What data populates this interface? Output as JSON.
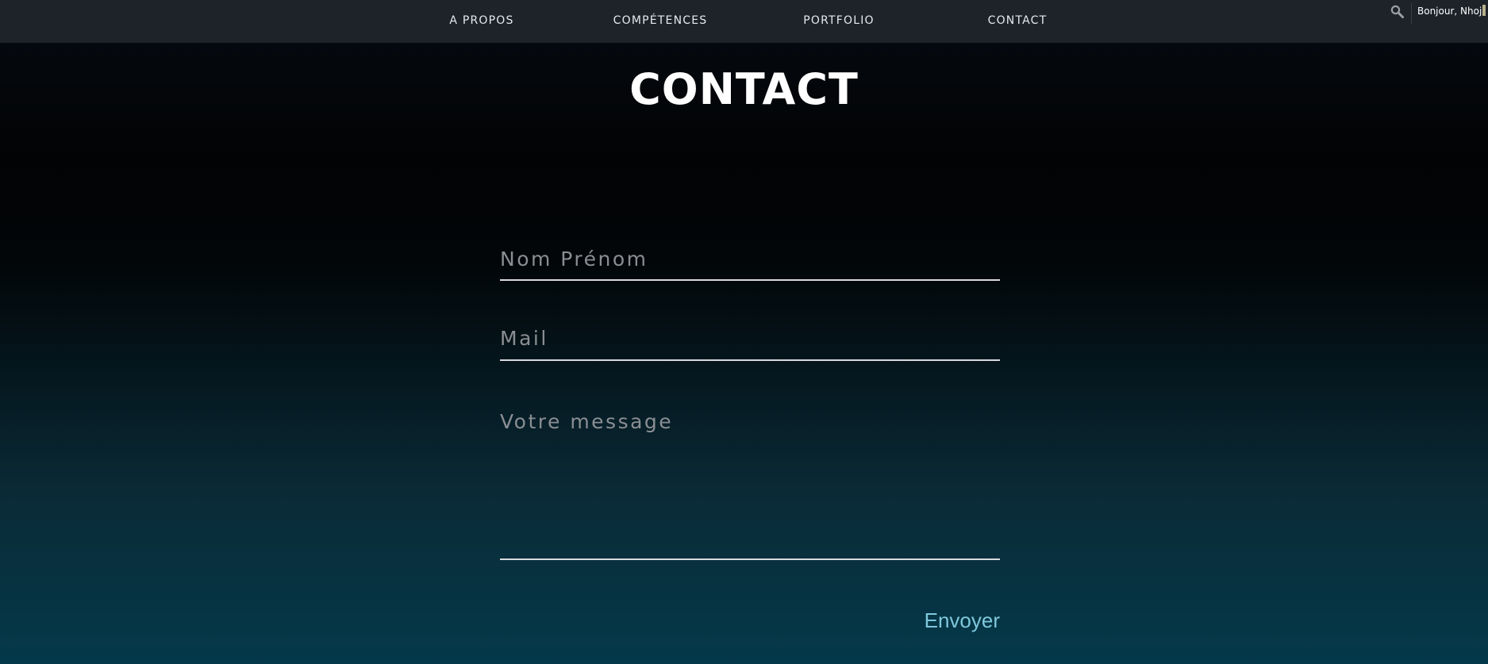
{
  "nav": {
    "items": [
      {
        "label": "A PROPOS"
      },
      {
        "label": "COMPÉTENCES"
      },
      {
        "label": "PORTFOLIO"
      },
      {
        "label": "CONTACT"
      }
    ]
  },
  "header": {
    "search_icon": "search-icon",
    "greeting": "Bonjour, Nhoj"
  },
  "page": {
    "title": "CONTACT"
  },
  "form": {
    "name_placeholder": "Nom Prénom",
    "name_value": "",
    "mail_placeholder": "Mail",
    "mail_value": "",
    "message_placeholder": "Votre message",
    "message_value": "",
    "send_label": "Envoyer"
  },
  "colors": {
    "topbar": "#1e232a",
    "accent": "#7fc8dc",
    "background_top": "#020304",
    "background_bottom": "#04394a"
  }
}
